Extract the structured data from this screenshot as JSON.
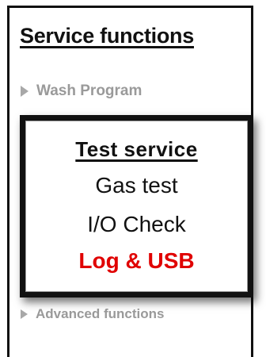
{
  "screen": {
    "title": "Service functions",
    "menu_items": [
      {
        "label": "Wash Program",
        "icon": "triangle-right-icon"
      },
      {
        "label": "Advanced functions",
        "icon": "triangle-right-icon"
      }
    ]
  },
  "popup": {
    "title": "Test service",
    "items": [
      {
        "label": "Gas test"
      },
      {
        "label": "I/O Check"
      },
      {
        "label": "Log & USB",
        "highlight": true,
        "color": "#e00000"
      }
    ]
  },
  "colors": {
    "text": "#111111",
    "muted": "#9a9a9a",
    "highlight": "#e00000"
  }
}
